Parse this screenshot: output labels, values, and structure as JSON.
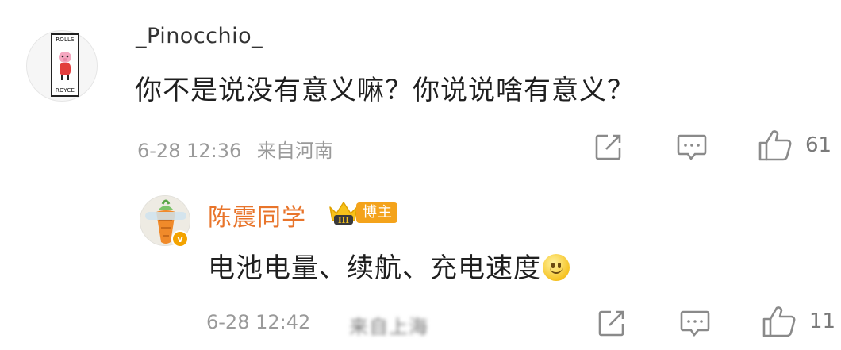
{
  "comments": [
    {
      "username": "_Pinocchio_",
      "text": "你不是说没有意义嘛？你说说啥有意义？",
      "time": "6-28 12:36",
      "location": "来自河南",
      "likes": "61",
      "avatar_badge": {
        "top": "ROLLS",
        "bottom": "ROYCE"
      }
    }
  ],
  "reply": {
    "username": "陈震同学",
    "badge_label": "博主",
    "crown_level": "III",
    "verified_mark": "v",
    "text": "电池电量、续航、充电速度",
    "time": "6-28 12:42",
    "location": "来自上海",
    "likes": "11"
  },
  "colors": {
    "username_blogger": "#e8742a",
    "badge_bg": "#f4a31b",
    "meta_text": "#9a9a9a",
    "verified": "#f3a300"
  },
  "icons": [
    "share-icon",
    "comment-icon",
    "like-icon",
    "verified-icon",
    "crown-icon",
    "smile-emoji-icon"
  ]
}
